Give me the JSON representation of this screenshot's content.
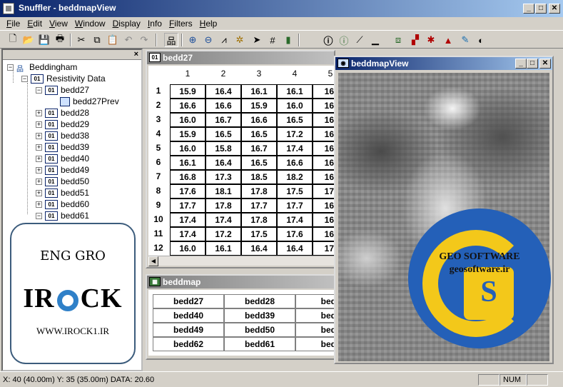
{
  "app": {
    "title": "Snuffler - beddmapView"
  },
  "window_controls": [
    "_",
    "□",
    "✕"
  ],
  "menu": [
    "File",
    "Edit",
    "View",
    "Window",
    "Display",
    "Info",
    "Filters",
    "Help"
  ],
  "toolbar_icons": [
    "new-icon",
    "open-icon",
    "save-icon",
    "print-icon",
    "cut-icon",
    "copy-icon",
    "paste-icon",
    "undo-icon",
    "redo-icon",
    "network-icon",
    "zoom-in-icon",
    "zoom-out-icon",
    "graph-icon",
    "settings-icon",
    "arrow-icon",
    "grid-icon",
    "export-icon",
    "info-icon",
    "info2-icon",
    "edit-icon",
    "chart-icon",
    "refresh-icon",
    "filter-icon",
    "despike-icon",
    "peak-icon",
    "brush-icon",
    "contrast-icon"
  ],
  "tree": {
    "root": "Beddingham",
    "group": "Resistivity Data",
    "items": [
      {
        "label": "bedd27",
        "expanded": true
      },
      {
        "label": "bedd27Prev",
        "child": true
      },
      {
        "label": "bedd28"
      },
      {
        "label": "bedd29"
      },
      {
        "label": "bedd38"
      },
      {
        "label": "bedd39"
      },
      {
        "label": "bedd40"
      },
      {
        "label": "bedd49"
      },
      {
        "label": "bedd50"
      },
      {
        "label": "bedd51"
      },
      {
        "label": "bedd60"
      },
      {
        "label": "bedd61",
        "expanded": true
      }
    ]
  },
  "irock": {
    "line1": "ENG GRO",
    "brand_left": "IR",
    "brand_right": "CK",
    "url": "WWW.IROCK1.IR"
  },
  "grid_window": {
    "title": "bedd27",
    "columns": [
      "1",
      "2",
      "3",
      "4",
      "5"
    ],
    "rows": [
      {
        "id": "1",
        "values": [
          "15.9",
          "16.4",
          "16.1",
          "16.1",
          "16."
        ]
      },
      {
        "id": "2",
        "values": [
          "16.6",
          "16.6",
          "15.9",
          "16.0",
          "16."
        ]
      },
      {
        "id": "3",
        "values": [
          "16.0",
          "16.7",
          "16.6",
          "16.5",
          "16."
        ]
      },
      {
        "id": "4",
        "values": [
          "15.9",
          "16.5",
          "16.5",
          "17.2",
          "16."
        ]
      },
      {
        "id": "5",
        "values": [
          "16.0",
          "15.8",
          "16.7",
          "17.4",
          "16."
        ]
      },
      {
        "id": "6",
        "values": [
          "16.1",
          "16.4",
          "16.5",
          "16.6",
          "16."
        ]
      },
      {
        "id": "7",
        "values": [
          "16.8",
          "17.3",
          "18.5",
          "18.2",
          "16."
        ]
      },
      {
        "id": "8",
        "values": [
          "17.6",
          "18.1",
          "17.8",
          "17.5",
          "17."
        ]
      },
      {
        "id": "9",
        "values": [
          "17.7",
          "17.8",
          "17.7",
          "17.7",
          "16."
        ]
      },
      {
        "id": "10",
        "values": [
          "17.4",
          "17.4",
          "17.8",
          "17.4",
          "16."
        ]
      },
      {
        "id": "11",
        "values": [
          "17.4",
          "17.2",
          "17.5",
          "17.6",
          "16."
        ]
      },
      {
        "id": "12",
        "values": [
          "16.0",
          "16.1",
          "16.4",
          "16.4",
          "17."
        ]
      }
    ]
  },
  "map_window": {
    "title": "beddmap",
    "rows": [
      [
        "bedd27",
        "bedd28",
        "bedd"
      ],
      [
        "bedd40",
        "bedd39",
        "bedd"
      ],
      [
        "bedd49",
        "bedd50",
        "bedd"
      ],
      [
        "bedd62",
        "bedd61",
        "bedd"
      ]
    ]
  },
  "map_view": {
    "title": "beddmapView"
  },
  "geo_badge": {
    "line1": "GEO SOFTWARE",
    "line2": "geosoftware.ir",
    "letter": "S"
  },
  "status": {
    "text": "X: 40 (40.00m)  Y: 35 (35.00m)  DATA: 20.60",
    "num": "NUM"
  },
  "colors": {
    "title_active": "#0a246a",
    "badge_blue": "#2460b8",
    "badge_yellow": "#f3c81a",
    "irock_blue": "#2f80c8"
  }
}
